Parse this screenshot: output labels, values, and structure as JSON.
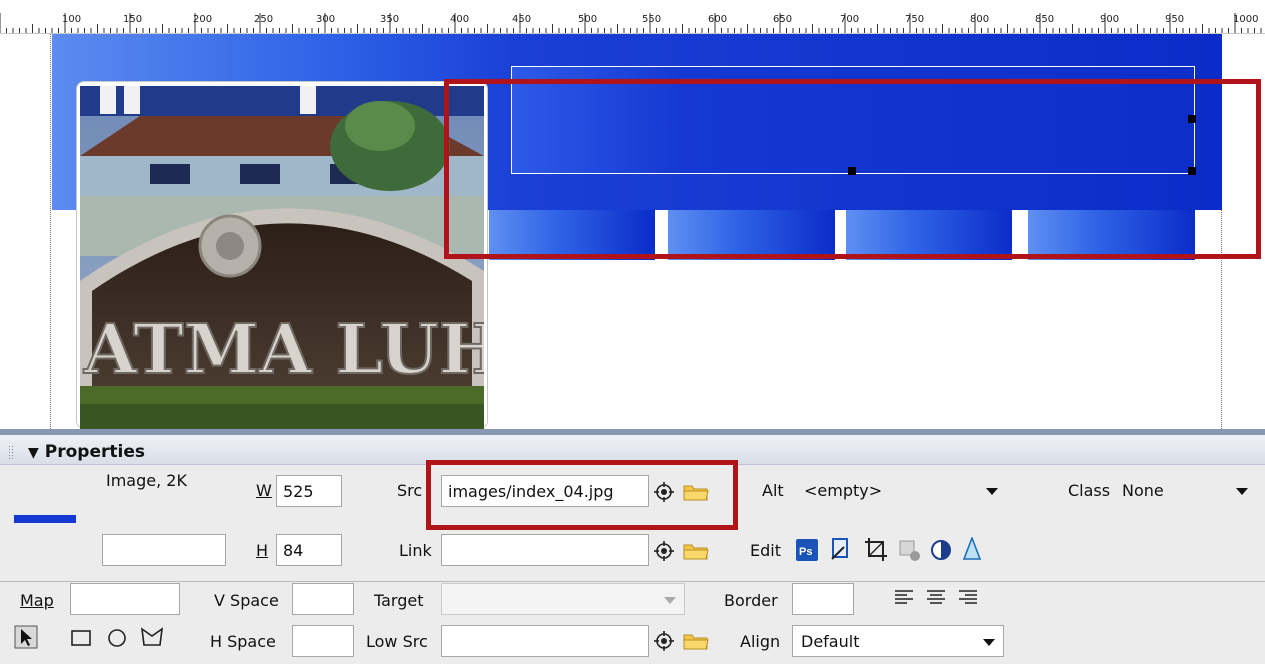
{
  "ruler": {
    "labels": [
      "100",
      "150",
      "200",
      "250",
      "300",
      "350",
      "400",
      "450",
      "500",
      "550",
      "600",
      "650",
      "700",
      "750",
      "800",
      "850",
      "900",
      "950",
      "1000"
    ]
  },
  "canvas": {
    "photo_alt_text": "ATMA LUHUR"
  },
  "properties": {
    "title": "Properties",
    "type_label": "Image, 2K",
    "w_label": "W",
    "w_value": "525",
    "h_label": "H",
    "h_value": "84",
    "src_label": "Src",
    "src_value": "images/index_04.jpg",
    "link_label": "Link",
    "link_value": "",
    "alt_label": "Alt",
    "alt_value": "<empty>",
    "class_label": "Class",
    "class_value": "None",
    "edit_label": "Edit",
    "map_label": "Map",
    "map_value": "",
    "vspace_label": "V Space",
    "hspace_label": "H Space",
    "target_label": "Target",
    "lowsrc_label": "Low Src",
    "border_label": "Border",
    "align_label": "Align",
    "align_value": "Default"
  },
  "colors": {
    "accent_blue": "#1538d2",
    "highlight_red": "#b0131a",
    "panel_bg": "#ececec"
  },
  "icons": [
    "point-to-file-icon",
    "folder-icon",
    "photoshop-icon",
    "edit-image-icon",
    "crop-icon",
    "resample-icon",
    "brightness-contrast-icon",
    "sharpen-icon",
    "align-left-icon",
    "align-center-icon",
    "align-right-icon",
    "pointer-hotspot-icon",
    "rectangle-hotspot-icon",
    "circle-hotspot-icon",
    "polygon-hotspot-icon"
  ]
}
